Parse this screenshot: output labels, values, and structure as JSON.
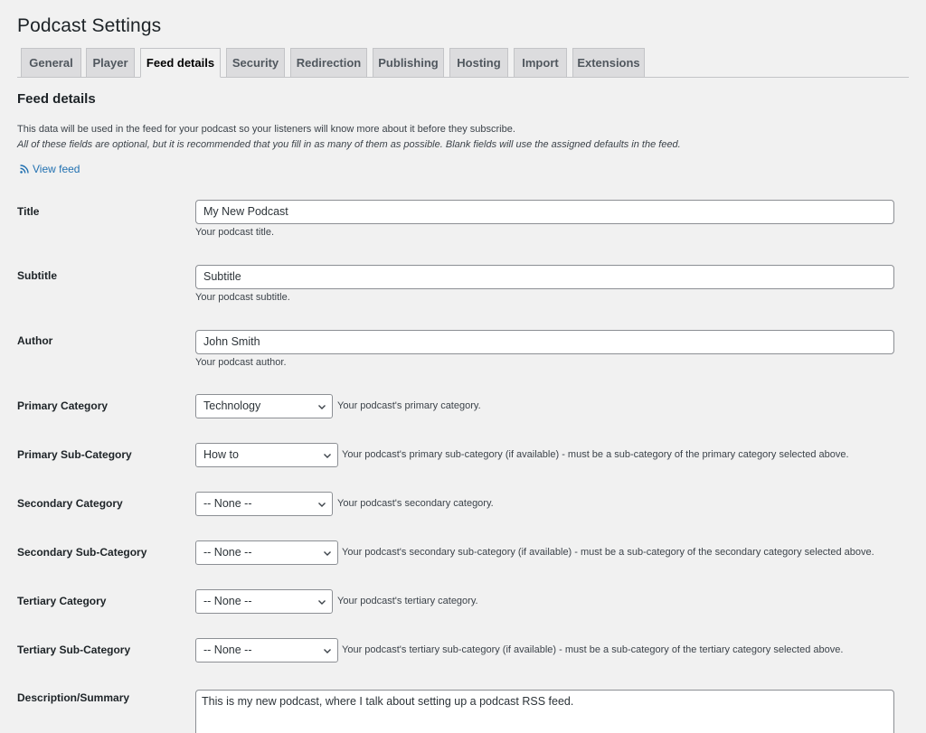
{
  "page": {
    "title": "Podcast Settings"
  },
  "tabs": [
    {
      "label": "General"
    },
    {
      "label": "Player"
    },
    {
      "label": "Feed details",
      "active": true
    },
    {
      "label": "Security"
    },
    {
      "label": "Redirection"
    },
    {
      "label": "Publishing"
    },
    {
      "label": "Hosting"
    },
    {
      "label": "Import"
    },
    {
      "label": "Extensions"
    }
  ],
  "section": {
    "title": "Feed details",
    "intro_line1": "This data will be used in the feed for your podcast so your listeners will know more about it before they subscribe.",
    "intro_line2": "All of these fields are optional, but it is recommended that you fill in as many of them as possible. Blank fields will use the assigned defaults in the feed.",
    "view_feed_label": "View feed",
    "view_feed_icon": "rss-icon"
  },
  "fields": {
    "title": {
      "label": "Title",
      "value": "My New Podcast",
      "help": "Your podcast title."
    },
    "subtitle": {
      "label": "Subtitle",
      "value": "Subtitle",
      "help": "Your podcast subtitle."
    },
    "author": {
      "label": "Author",
      "value": "John Smith",
      "help": "Your podcast author."
    },
    "primary_category": {
      "label": "Primary Category",
      "value": "Technology",
      "help": "Your podcast's primary category."
    },
    "primary_sub_category": {
      "label": "Primary Sub-Category",
      "value": "How to",
      "help": "Your podcast's primary sub-category (if available) - must be a sub-category of the primary category selected above."
    },
    "secondary_category": {
      "label": "Secondary Category",
      "value": "-- None --",
      "help": "Your podcast's secondary category."
    },
    "secondary_sub_category": {
      "label": "Secondary Sub-Category",
      "value": "-- None --",
      "help": "Your podcast's secondary sub-category (if available) - must be a sub-category of the secondary category selected above."
    },
    "tertiary_category": {
      "label": "Tertiary Category",
      "value": "-- None --",
      "help": "Your podcast's tertiary category."
    },
    "tertiary_sub_category": {
      "label": "Tertiary Sub-Category",
      "value": "-- None --",
      "help": "Your podcast's tertiary sub-category (if available) - must be a sub-category of the tertiary category selected above."
    },
    "description": {
      "label": "Description/Summary",
      "value": "This is my new podcast, where I talk about setting up a podcast RSS feed."
    }
  },
  "colors": {
    "background": "#f1f1f1",
    "link": "#2271b1",
    "tab_inactive": "#dcdcde",
    "border": "#8c8f94"
  }
}
